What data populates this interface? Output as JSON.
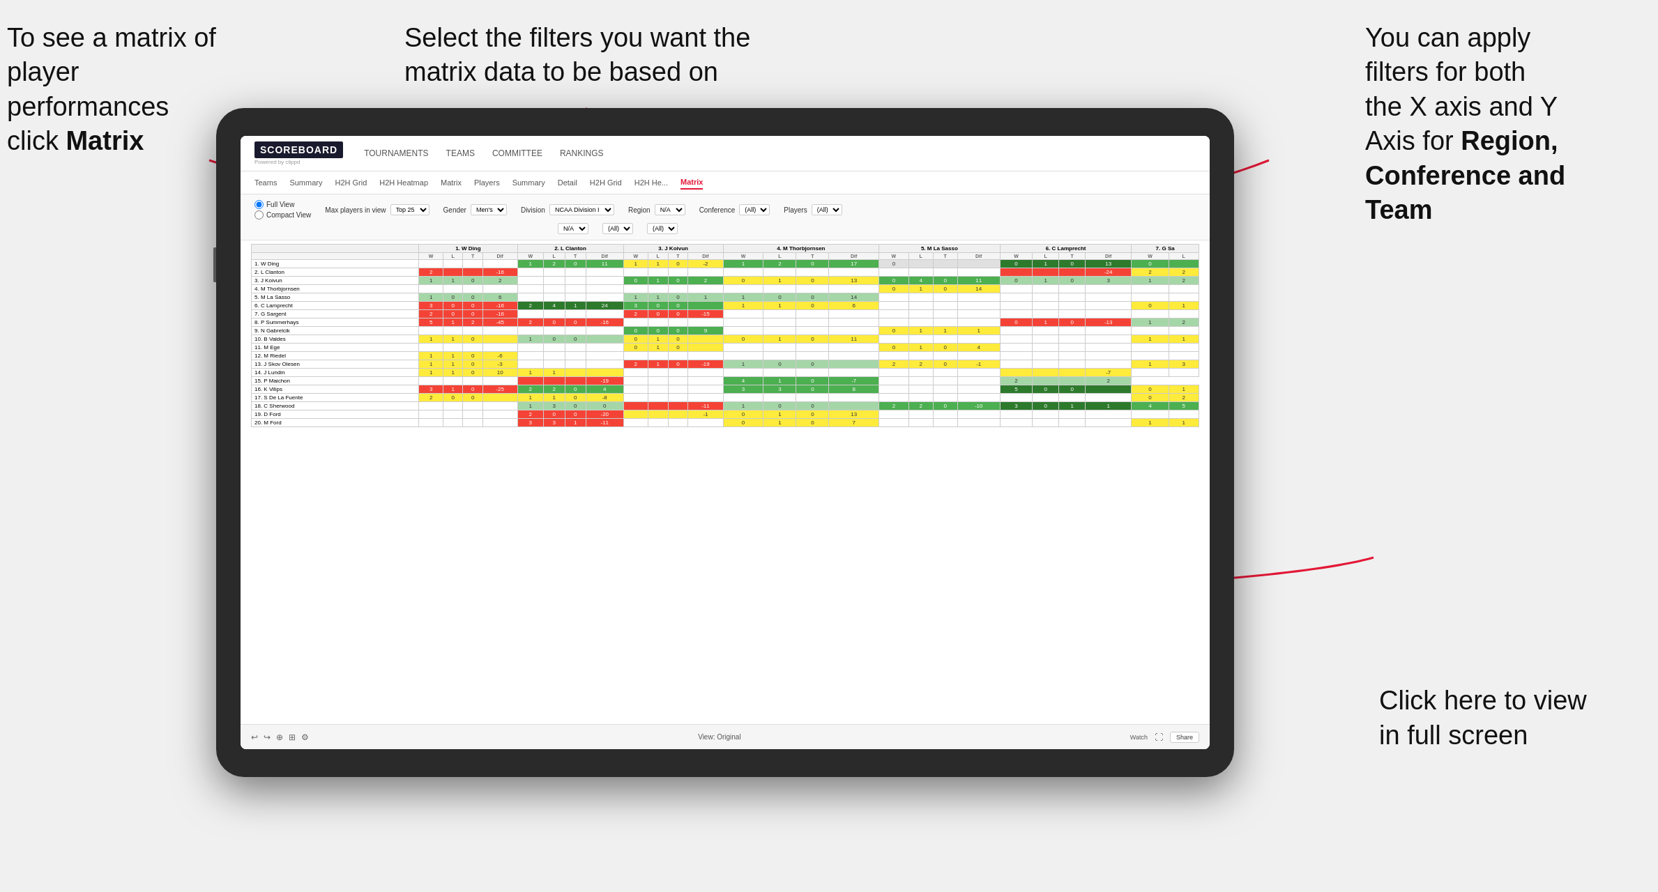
{
  "annotations": {
    "topleft": {
      "line1": "To see a matrix of",
      "line2": "player performances",
      "line3_normal": "click ",
      "line3_bold": "Matrix"
    },
    "topcenter": {
      "line1": "Select the filters you want the",
      "line2": "matrix data to be based on"
    },
    "topright": {
      "line1": "You  can apply",
      "line2": "filters for both",
      "line3": "the X axis and Y",
      "line4_normal": "Axis for ",
      "line4_bold": "Region,",
      "line5_bold": "Conference and",
      "line6_bold": "Team"
    },
    "bottomright": {
      "line1": "Click here to view",
      "line2": "in full screen"
    }
  },
  "nav": {
    "logo": "SCOREBOARD",
    "logo_sub": "Powered by clippd",
    "items": [
      "TOURNAMENTS",
      "TEAMS",
      "COMMITTEE",
      "RANKINGS"
    ]
  },
  "subnav": {
    "items": [
      "Teams",
      "Summary",
      "H2H Grid",
      "H2H Heatmap",
      "Matrix",
      "Players",
      "Summary",
      "Detail",
      "H2H Grid",
      "H2H He...",
      "Matrix"
    ],
    "active_index": 10
  },
  "filters": {
    "view_options": [
      "Full View",
      "Compact View"
    ],
    "max_players_label": "Max players in view",
    "max_players_value": "Top 25",
    "gender_label": "Gender",
    "gender_value": "Men's",
    "division_label": "Division",
    "division_value": "NCAA Division I",
    "region_label": "Region",
    "region_value": "N/A",
    "conference_label": "Conference",
    "conference_value": "(All)",
    "players_label": "Players",
    "players_value": "(All)"
  },
  "matrix": {
    "column_headers": [
      "1. W Ding",
      "2. L Clanton",
      "3. J Koivun",
      "4. M Thorbjornsen",
      "5. M La Sasso",
      "6. C Lamprecht",
      "7. G Sa"
    ],
    "sub_headers": [
      "W",
      "L",
      "T",
      "Dif"
    ],
    "rows": [
      {
        "name": "1. W Ding",
        "data": [
          {
            "w": "",
            "l": "",
            "t": "",
            "d": ""
          },
          {
            "w": "1",
            "l": "2",
            "t": "0",
            "d": "11"
          },
          {
            "w": "1",
            "l": "1",
            "t": "0",
            "d": "-2"
          },
          {
            "w": "1",
            "l": "2",
            "t": "0",
            "d": "17"
          },
          {
            "w": "0",
            "l": "",
            "t": "",
            "d": ""
          },
          {
            "w": "0",
            "l": "1",
            "t": "0",
            "d": "13"
          },
          {
            "w": "0",
            "l": ""
          }
        ]
      },
      {
        "name": "2. L Clanton",
        "data": [
          {
            "w": "2",
            "l": "",
            "t": "",
            "d": "-16"
          },
          {
            "w": "",
            "l": "",
            "t": "",
            "d": ""
          },
          {
            "w": "",
            "l": "",
            "t": "",
            "d": ""
          },
          {
            "w": "",
            "l": "",
            "t": "",
            "d": ""
          },
          {
            "w": "",
            "l": "",
            "t": "",
            "d": ""
          },
          {
            "w": "",
            "l": "",
            "t": "",
            "d": "-24"
          },
          {
            "w": "2",
            "l": "2"
          }
        ]
      },
      {
        "name": "3. J Koivun",
        "data": [
          {
            "w": "1",
            "l": "1",
            "t": "0",
            "d": "2"
          },
          {
            "w": "",
            "l": "",
            "t": "",
            "d": ""
          },
          {
            "w": "0",
            "l": "1",
            "t": "0",
            "d": "2"
          },
          {
            "w": "0",
            "l": "1",
            "t": "0",
            "d": "13"
          },
          {
            "w": "0",
            "l": "4",
            "t": "0",
            "d": "11"
          },
          {
            "w": "0",
            "l": "1",
            "t": "0",
            "d": "3"
          },
          {
            "w": "1",
            "l": "2"
          }
        ]
      },
      {
        "name": "4. M Thorbjornsen",
        "data": [
          {
            "w": "",
            "l": "",
            "t": "",
            "d": ""
          },
          {
            "w": "",
            "l": "",
            "t": "",
            "d": ""
          },
          {
            "w": "",
            "l": "",
            "t": "",
            "d": ""
          },
          {
            "w": "",
            "l": "",
            "t": "",
            "d": ""
          },
          {
            "w": "0",
            "l": "1",
            "t": "0",
            "d": "14"
          },
          {
            "w": "",
            "l": "",
            "t": "",
            "d": ""
          },
          {
            "w": ""
          }
        ]
      },
      {
        "name": "5. M La Sasso",
        "data": [
          {
            "w": "1",
            "l": "0",
            "t": "0",
            "d": "6"
          },
          {
            "w": "",
            "l": "",
            "t": "",
            "d": ""
          },
          {
            "w": "1",
            "l": "1",
            "t": "0",
            "d": "1"
          },
          {
            "w": "1",
            "l": "0",
            "t": "0",
            "d": "14"
          },
          {
            "w": "",
            "l": "",
            "t": "",
            "d": ""
          },
          {
            "w": "",
            "l": "",
            "t": "",
            "d": ""
          },
          {
            "w": ""
          }
        ]
      },
      {
        "name": "6. C Lamprecht",
        "data": [
          {
            "w": "3",
            "l": "0",
            "t": "0",
            "d": "-16"
          },
          {
            "w": "2",
            "l": "4",
            "t": "1",
            "d": "24"
          },
          {
            "w": "3",
            "l": "0",
            "t": "0",
            "d": ""
          },
          {
            "w": "1",
            "l": "1",
            "t": "0",
            "d": "6"
          },
          {
            "w": "",
            "l": "",
            "t": "",
            "d": ""
          },
          {
            "w": "",
            "l": "",
            "t": "",
            "d": ""
          },
          {
            "w": "0",
            "l": "1"
          }
        ]
      },
      {
        "name": "7. G Sargent",
        "data": [
          {
            "w": "2",
            "l": "0",
            "t": "0",
            "d": "-16"
          },
          {
            "w": "",
            "l": "",
            "t": "",
            "d": ""
          },
          {
            "w": "2",
            "l": "0",
            "t": "0",
            "d": "-15"
          },
          {
            "w": "",
            "l": "",
            "t": "",
            "d": ""
          },
          {
            "w": "",
            "l": "",
            "t": "",
            "d": ""
          },
          {
            "w": "",
            "l": "",
            "t": "",
            "d": ""
          },
          {
            "w": ""
          }
        ]
      },
      {
        "name": "8. P Summerhays",
        "data": [
          {
            "w": "5",
            "l": "1",
            "t": "2",
            "d": "-45"
          },
          {
            "w": "2",
            "l": "0",
            "t": "0",
            "d": "-16"
          },
          {
            "w": "",
            "l": "",
            "t": "",
            "d": ""
          },
          {
            "w": "",
            "l": "",
            "t": "",
            "d": ""
          },
          {
            "w": "",
            "l": "",
            "t": "",
            "d": ""
          },
          {
            "w": "0",
            "l": "1",
            "t": "0",
            "d": "-13"
          },
          {
            "w": "1",
            "l": "2"
          }
        ]
      },
      {
        "name": "9. N Gabrelcik",
        "data": [
          {
            "w": "",
            "l": "",
            "t": "",
            "d": ""
          },
          {
            "w": "",
            "l": "",
            "t": "",
            "d": ""
          },
          {
            "w": "0",
            "l": "0",
            "t": "0",
            "d": "9"
          },
          {
            "w": "",
            "l": "",
            "t": "",
            "d": ""
          },
          {
            "w": "0",
            "l": "1",
            "t": "1",
            "d": "1"
          },
          {
            "w": "",
            "l": "",
            "t": "",
            "d": ""
          },
          {
            "w": ""
          }
        ]
      },
      {
        "name": "10. B Valdes",
        "data": [
          {
            "w": "1",
            "l": "1",
            "t": "0",
            "d": ""
          },
          {
            "w": "1",
            "l": "0",
            "t": "0",
            "d": ""
          },
          {
            "w": "0",
            "l": "1",
            "t": "0",
            "d": ""
          },
          {
            "w": "0",
            "l": "1",
            "t": "0",
            "d": "11"
          },
          {
            "w": "",
            "l": "",
            "t": "",
            "d": ""
          },
          {
            "w": "",
            "l": "",
            "t": "",
            "d": ""
          },
          {
            "w": "1",
            "l": "1"
          }
        ]
      },
      {
        "name": "11. M Ege",
        "data": [
          {
            "w": "",
            "l": "",
            "t": "",
            "d": ""
          },
          {
            "w": "",
            "l": "",
            "t": "",
            "d": ""
          },
          {
            "w": "0",
            "l": "1",
            "t": "0",
            "d": ""
          },
          {
            "w": "",
            "l": "",
            "t": "",
            "d": ""
          },
          {
            "w": "0",
            "l": "1",
            "t": "0",
            "d": "4"
          },
          {
            "w": "",
            "l": "",
            "t": "",
            "d": ""
          },
          {
            "w": ""
          }
        ]
      },
      {
        "name": "12. M Riedel",
        "data": [
          {
            "w": "1",
            "l": "1",
            "t": "0",
            "d": "-6"
          },
          {
            "w": "",
            "l": "",
            "t": "",
            "d": ""
          },
          {
            "w": "",
            "l": "",
            "t": "",
            "d": ""
          },
          {
            "w": "",
            "l": "",
            "t": "",
            "d": ""
          },
          {
            "w": "",
            "l": "",
            "t": "",
            "d": ""
          },
          {
            "w": "",
            "l": "",
            "t": "",
            "d": ""
          },
          {
            "w": ""
          }
        ]
      },
      {
        "name": "13. J Skov Olesen",
        "data": [
          {
            "w": "1",
            "l": "1",
            "t": "0",
            "d": "-3"
          },
          {
            "w": "",
            "l": "",
            "t": "",
            "d": ""
          },
          {
            "w": "2",
            "l": "1",
            "t": "0",
            "d": "-19"
          },
          {
            "w": "1",
            "l": "0",
            "t": "0",
            "d": ""
          },
          {
            "w": "2",
            "l": "2",
            "t": "0",
            "d": "-1"
          },
          {
            "w": "",
            "l": "",
            "t": "",
            "d": ""
          },
          {
            "w": "1",
            "l": "3"
          }
        ]
      },
      {
        "name": "14. J Lundin",
        "data": [
          {
            "w": "1",
            "l": "1",
            "t": "0",
            "d": "10"
          },
          {
            "w": "1",
            "l": "1",
            "t": "",
            "d": ""
          },
          {
            "w": "",
            "l": "",
            "t": "",
            "d": ""
          },
          {
            "w": "",
            "l": "",
            "t": "",
            "d": ""
          },
          {
            "w": "",
            "l": "",
            "t": "",
            "d": ""
          },
          {
            "w": "",
            "l": "",
            "t": "",
            "d": "-7"
          },
          {
            "w": ""
          }
        ]
      },
      {
        "name": "15. P Maichon",
        "data": [
          {
            "w": "",
            "l": "",
            "t": "",
            "d": ""
          },
          {
            "w": "",
            "l": "",
            "t": "",
            "d": "-19"
          },
          {
            "w": "",
            "l": "",
            "t": "",
            "d": ""
          },
          {
            "w": "4",
            "l": "1",
            "t": "0",
            "d": "-7"
          },
          {
            "w": "",
            "l": "",
            "t": "",
            "d": ""
          },
          {
            "w": "2",
            "l": "",
            "t": "",
            "d": "2"
          }
        ]
      },
      {
        "name": "16. K Vilips",
        "data": [
          {
            "w": "3",
            "l": "1",
            "t": "0",
            "d": "-25"
          },
          {
            "w": "2",
            "l": "2",
            "t": "0",
            "d": "4"
          },
          {
            "w": "",
            "l": "",
            "t": "",
            "d": ""
          },
          {
            "w": "3",
            "l": "3",
            "t": "0",
            "d": "8"
          },
          {
            "w": "",
            "l": "",
            "t": "",
            "d": ""
          },
          {
            "w": "5",
            "l": "0",
            "t": "0",
            "d": ""
          },
          {
            "w": "0",
            "l": "1"
          }
        ]
      },
      {
        "name": "17. S De La Fuente",
        "data": [
          {
            "w": "2",
            "l": "0",
            "t": "0",
            "d": ""
          },
          {
            "w": "1",
            "l": "1",
            "t": "0",
            "d": "-8"
          },
          {
            "w": "",
            "l": "",
            "t": "",
            "d": ""
          },
          {
            "w": "",
            "l": "",
            "t": "",
            "d": ""
          },
          {
            "w": "",
            "l": "",
            "t": "",
            "d": ""
          },
          {
            "w": "",
            "l": "",
            "t": "",
            "d": ""
          },
          {
            "w": "0",
            "l": "2"
          }
        ]
      },
      {
        "name": "18. C Sherwood",
        "data": [
          {
            "w": "",
            "l": "",
            "t": "",
            "d": ""
          },
          {
            "w": "1",
            "l": "3",
            "t": "0",
            "d": "0"
          },
          {
            "w": "",
            "l": "",
            "t": "",
            "d": "-11"
          },
          {
            "w": "1",
            "l": "0",
            "t": "0",
            "d": ""
          },
          {
            "w": "2",
            "l": "2",
            "t": "0",
            "d": "-10"
          },
          {
            "w": "3",
            "l": "0",
            "t": "1",
            "d": "1"
          },
          {
            "w": "4",
            "l": "5"
          }
        ]
      },
      {
        "name": "19. D Ford",
        "data": [
          {
            "w": "",
            "l": "",
            "t": "",
            "d": ""
          },
          {
            "w": "2",
            "l": "0",
            "t": "0",
            "d": "-20"
          },
          {
            "w": "",
            "l": "",
            "t": "",
            "d": "-1"
          },
          {
            "w": "0",
            "l": "1",
            "t": "0",
            "d": "13"
          },
          {
            "w": "",
            "l": "",
            "t": "",
            "d": ""
          },
          {
            "w": "",
            "l": "",
            "t": "",
            "d": ""
          },
          {
            "w": ""
          }
        ]
      },
      {
        "name": "20. M Ford",
        "data": [
          {
            "w": "",
            "l": "",
            "t": "",
            "d": ""
          },
          {
            "w": "3",
            "l": "3",
            "t": "1",
            "d": "-11"
          },
          {
            "w": "",
            "l": "",
            "t": "",
            "d": ""
          },
          {
            "w": "0",
            "l": "1",
            "t": "0",
            "d": "7"
          },
          {
            "w": "",
            "l": "",
            "t": "",
            "d": ""
          },
          {
            "w": "",
            "l": "",
            "t": "",
            "d": ""
          },
          {
            "w": "1",
            "l": "1"
          }
        ]
      }
    ]
  },
  "toolbar": {
    "view_label": "View: Original",
    "watch_label": "Watch",
    "share_label": "Share"
  }
}
